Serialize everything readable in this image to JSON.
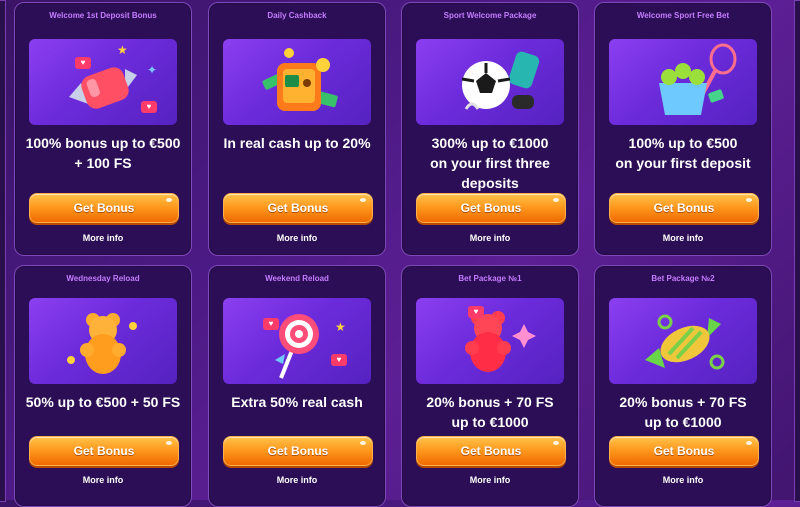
{
  "cards": [
    {
      "title": "Welcome 1st Deposit Bonus",
      "offer": "100% bonus up to €500\n+ 100 FS",
      "button": "Get Bonus",
      "more": "More info",
      "icon": "candy-icon"
    },
    {
      "title": "Daily Cashback",
      "offer": "In real cash up to 20%",
      "button": "Get Bonus",
      "more": "More info",
      "icon": "safe-icon"
    },
    {
      "title": "Sport Welcome Package",
      "offer": "300% up to €1000\non your first three\ndeposits",
      "button": "Get Bonus",
      "more": "More info",
      "icon": "soccer-ball-icon"
    },
    {
      "title": "Welcome Sport Free Bet",
      "offer": "100% up to €500\non your first deposit",
      "button": "Get Bonus",
      "more": "More info",
      "icon": "tennis-bucket-icon"
    },
    {
      "title": "Wednesday Reload",
      "offer": "50% up to €500 + 50 FS",
      "button": "Get Bonus",
      "more": "More info",
      "icon": "gummy-bear-icon"
    },
    {
      "title": "Weekend Reload",
      "offer": "Extra 50% real cash",
      "button": "Get Bonus",
      "more": "More info",
      "icon": "lollipop-icon"
    },
    {
      "title": "Bet Package №1",
      "offer": "20% bonus + 70 FS\nup to €1000",
      "button": "Get Bonus",
      "more": "More info",
      "icon": "gummy-bear-icon"
    },
    {
      "title": "Bet Package №2",
      "offer": "20% bonus + 70 FS\nup to €1000",
      "button": "Get Bonus",
      "more": "More info",
      "icon": "candy-icon"
    }
  ],
  "colors": {
    "title": "#c57dff",
    "button": "#ff9a1f",
    "card": "#2b0e55"
  }
}
